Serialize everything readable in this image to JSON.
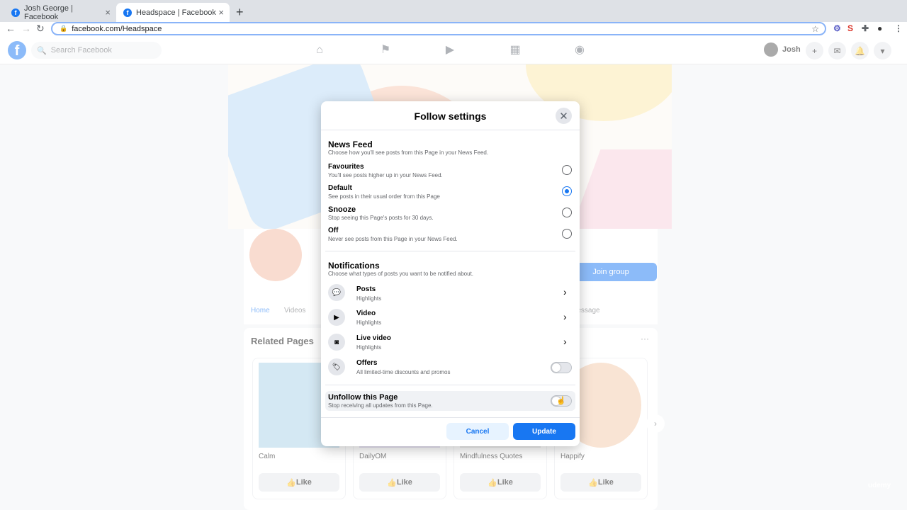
{
  "browser": {
    "tabs": [
      {
        "title": "Josh George | Facebook"
      },
      {
        "title": "Headspace | Facebook"
      }
    ],
    "url": "facebook.com/Headspace"
  },
  "fb_nav": {
    "logo": "f",
    "search_placeholder": "Search Facebook",
    "user_name": "Josh"
  },
  "page": {
    "join_button": "Join group",
    "tabs": [
      "Home",
      "Videos",
      "Message"
    ],
    "related_title": "Related Pages",
    "related_more": "···",
    "related": [
      {
        "name": "Calm",
        "like": "Like",
        "color": "#a8d0e6"
      },
      {
        "name": "DailyOM",
        "like": "Like",
        "color": "#cfc6e8"
      },
      {
        "name": "Mindfulness Quotes",
        "like": "Like",
        "color": "#d8d8d8"
      },
      {
        "name": "Happify",
        "like": "Like",
        "color": "#f3c9a8"
      }
    ],
    "watermark": "udemy"
  },
  "modal": {
    "title": "Follow settings",
    "news_feed": {
      "title": "News Feed",
      "subtitle": "Choose how you'll see posts from this Page in your News Feed.",
      "options": [
        {
          "label": "Favourites",
          "desc": "You'll see posts higher up in your News Feed.",
          "selected": false
        },
        {
          "label": "Default",
          "desc": "See posts in their usual order from this Page",
          "selected": true
        },
        {
          "label": "Snooze",
          "desc": "Stop seeing this Page's posts for 30 days.",
          "selected": false
        },
        {
          "label": "Off",
          "desc": "Never see posts from this Page in your News Feed.",
          "selected": false
        }
      ]
    },
    "notifications": {
      "title": "Notifications",
      "subtitle": "Choose what types of posts you want to be notified about.",
      "items": [
        {
          "label": "Posts",
          "desc": "Highlights",
          "icon": "posts-icon"
        },
        {
          "label": "Video",
          "desc": "Highlights",
          "icon": "video-icon"
        },
        {
          "label": "Live video",
          "desc": "Highlights",
          "icon": "live-video-icon"
        },
        {
          "label": "Offers",
          "desc": "All limited-time discounts and promos",
          "icon": "offers-icon"
        }
      ]
    },
    "unfollow": {
      "label": "Unfollow this Page",
      "desc": "Stop receiving all updates from this Page."
    },
    "cancel": "Cancel",
    "update": "Update"
  },
  "colors": {
    "accent": "#1877f2",
    "light_accent": "#e7f3ff"
  }
}
